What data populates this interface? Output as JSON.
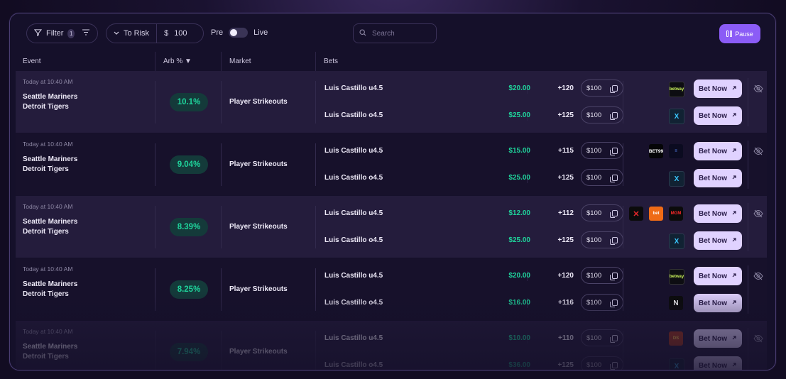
{
  "toolbar": {
    "filter_label": "Filter",
    "filter_count": "1",
    "risk_label": "To Risk",
    "currency": "$",
    "risk_value": "100",
    "pre_label": "Pre",
    "live_label": "Live",
    "search_placeholder": "Search",
    "pause_label": "Pause"
  },
  "columns": {
    "event": "Event",
    "arb": "Arb %",
    "market": "Market",
    "bets": "Bets"
  },
  "rows": [
    {
      "time": "Today at 10:40 AM",
      "team1": "Seattle Mariners",
      "team2": "Detroit Tigers",
      "arb": "10.1%",
      "market": "Player Strikeouts",
      "bets": [
        {
          "name": "Luis Castillo u4.5",
          "stake": "$20.00",
          "odds": "+120",
          "input": "$100",
          "books": [
            "betway"
          ],
          "button": "Bet Now"
        },
        {
          "name": "Luis Castillo o4.5",
          "stake": "$25.00",
          "odds": "+125",
          "input": "$100",
          "books": [
            "x"
          ],
          "button": "Bet Now"
        }
      ]
    },
    {
      "time": "Today at 10:40 AM",
      "team1": "Seattle Mariners",
      "team2": "Detroit Tigers",
      "arb": "9.04%",
      "market": "Player Strikeouts",
      "bets": [
        {
          "name": "Luis Castillo u4.5",
          "stake": "$15.00",
          "odds": "+115",
          "input": "$100",
          "books": [
            "bet99",
            "ss"
          ],
          "button": "Bet Now"
        },
        {
          "name": "Luis Castillo o4.5",
          "stake": "$25.00",
          "odds": "+125",
          "input": "$100",
          "books": [
            "x"
          ],
          "button": "Bet Now"
        }
      ]
    },
    {
      "time": "Today at 10:40 AM",
      "team1": "Seattle Mariners",
      "team2": "Detroit Tigers",
      "arb": "8.39%",
      "market": "Player Strikeouts",
      "bets": [
        {
          "name": "Luis Castillo u4.5",
          "stake": "$12.00",
          "odds": "+112",
          "input": "$100",
          "books": [
            "red",
            "orange",
            "mgm"
          ],
          "button": "Bet Now"
        },
        {
          "name": "Luis Castillo o4.5",
          "stake": "$25.00",
          "odds": "+125",
          "input": "$100",
          "books": [
            "x"
          ],
          "button": "Bet Now"
        }
      ]
    },
    {
      "time": "Today at 10:40 AM",
      "team1": "Seattle Mariners",
      "team2": "Detroit Tigers",
      "arb": "8.25%",
      "market": "Player Strikeouts",
      "bets": [
        {
          "name": "Luis Castillo u4.5",
          "stake": "$20.00",
          "odds": "+120",
          "input": "$100",
          "books": [
            "betway"
          ],
          "button": "Bet Now"
        },
        {
          "name": "Luis Castillo o4.5",
          "stake": "$16.00",
          "odds": "+116",
          "input": "$100",
          "books": [
            "n"
          ],
          "button": "Bet Now"
        }
      ]
    },
    {
      "time": "Today at 10:40 AM",
      "team1": "Seattle Mariners",
      "team2": "Detroit Tigers",
      "arb": "7.94%",
      "market": "Player Strikeouts",
      "bets": [
        {
          "name": "Luis Castillo u4.5",
          "stake": "$10.00",
          "odds": "+110",
          "input": "$100",
          "books": [
            "ds"
          ],
          "button": "Bet Now"
        },
        {
          "name": "Luis Castillo o4.5",
          "stake": "$36.00",
          "odds": "+125",
          "input": "$100",
          "books": [
            "x"
          ],
          "button": "Bet Now"
        }
      ]
    }
  ],
  "book_labels": {
    "betway": "betway",
    "x": "X",
    "bet99": "BET99",
    "ss": "≡",
    "red": "✕",
    "orange": "bet",
    "mgm": "MGM",
    "n": "N",
    "ds": "DS"
  },
  "colors": {
    "accent": "#8b5cf6",
    "positive": "#1fd39b",
    "button": "#e0d2ff"
  }
}
